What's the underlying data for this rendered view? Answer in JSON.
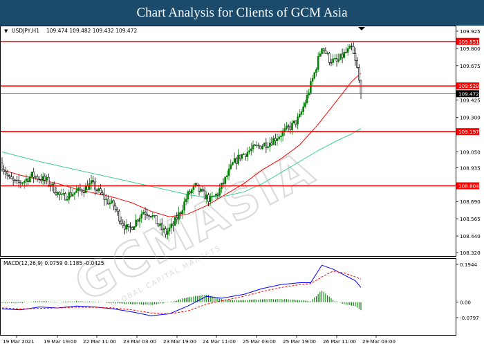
{
  "header": {
    "title": "Chart Analysis for Clients of GCM Asia"
  },
  "watermark": {
    "text": "GCMASIA",
    "subtext": "GLOBAL CAPITAL MARKETS"
  },
  "colors": {
    "bull_candle": "#008000",
    "bear_candle": "#000000",
    "fast_ma": "#ff0000",
    "slow_ma": "#3cd28c",
    "level_line": "#ff0000",
    "price_tag": "#000000",
    "macd_line": "#0000ff",
    "signal_line": "#ff0000",
    "histogram": "#008000"
  },
  "chart_data": [
    {
      "type": "candlestick",
      "symbol_label": "USDJPY,H1",
      "ohlc_label": "109.474 109.482 109.432 109.472",
      "y_ticks": [
        "109.925",
        "109.800",
        "109.675",
        "109.425",
        "109.300",
        "109.050",
        "108.935",
        "108.690",
        "108.565",
        "108.440",
        "108.320"
      ],
      "ylim": [
        108.32,
        109.925
      ],
      "levels": [
        {
          "value": 109.851,
          "label": "109.851"
        },
        {
          "value": 109.528,
          "label": "109.528"
        },
        {
          "value": 109.197,
          "label": "109.197"
        },
        {
          "value": 108.804,
          "label": "108.804"
        }
      ],
      "current_price": {
        "value": 109.472,
        "label": "109.472"
      },
      "x_ticks": [
        "19 Mar 2021",
        "19 Mar 19:00",
        "22 Mar 11:00",
        "23 Mar 03:00",
        "23 Mar 19:00",
        "24 Mar 11:00",
        "25 Mar 03:00",
        "25 Mar 19:00",
        "26 Mar 11:00",
        "29 Mar 03:00"
      ],
      "close_anchors": [
        [
          0,
          108.95
        ],
        [
          4,
          108.85
        ],
        [
          8,
          108.82
        ],
        [
          12,
          108.84
        ],
        [
          16,
          108.88
        ],
        [
          20,
          108.86
        ],
        [
          24,
          108.84
        ],
        [
          28,
          108.78
        ],
        [
          32,
          108.72
        ],
        [
          36,
          108.74
        ],
        [
          40,
          108.76
        ],
        [
          44,
          108.78
        ],
        [
          48,
          108.82
        ],
        [
          52,
          108.76
        ],
        [
          56,
          108.7
        ],
        [
          60,
          108.66
        ],
        [
          64,
          108.55
        ],
        [
          68,
          108.48
        ],
        [
          72,
          108.55
        ],
        [
          76,
          108.62
        ],
        [
          80,
          108.6
        ],
        [
          84,
          108.52
        ],
        [
          88,
          108.46
        ],
        [
          92,
          108.52
        ],
        [
          96,
          108.62
        ],
        [
          100,
          108.74
        ],
        [
          104,
          108.8
        ],
        [
          108,
          108.74
        ],
        [
          112,
          108.7
        ],
        [
          116,
          108.75
        ],
        [
          120,
          108.85
        ],
        [
          124,
          108.96
        ],
        [
          128,
          109.02
        ],
        [
          132,
          109.05
        ],
        [
          136,
          109.08
        ],
        [
          140,
          109.1
        ],
        [
          144,
          109.12
        ],
        [
          148,
          109.16
        ],
        [
          152,
          109.2
        ],
        [
          156,
          109.24
        ],
        [
          160,
          109.3
        ],
        [
          164,
          109.45
        ],
        [
          168,
          109.62
        ],
        [
          172,
          109.82
        ],
        [
          176,
          109.72
        ],
        [
          180,
          109.7
        ],
        [
          184,
          109.76
        ],
        [
          188,
          109.8
        ],
        [
          191,
          109.65
        ],
        [
          193,
          109.472
        ]
      ],
      "moving_averages": [
        {
          "name": "fast",
          "points": [
            [
              0,
              108.92
            ],
            [
              10,
              108.88
            ],
            [
              20,
              108.85
            ],
            [
              30,
              108.82
            ],
            [
              40,
              108.78
            ],
            [
              50,
              108.75
            ],
            [
              60,
              108.72
            ],
            [
              70,
              108.68
            ],
            [
              80,
              108.62
            ],
            [
              90,
              108.58
            ],
            [
              100,
              108.6
            ],
            [
              110,
              108.66
            ],
            [
              120,
              108.74
            ],
            [
              130,
              108.82
            ],
            [
              140,
              108.92
            ],
            [
              150,
              109.0
            ],
            [
              160,
              109.1
            ],
            [
              170,
              109.25
            ],
            [
              180,
              109.42
            ],
            [
              188,
              109.56
            ],
            [
              193,
              109.62
            ]
          ]
        },
        {
          "name": "slow",
          "points": [
            [
              0,
              109.05
            ],
            [
              20,
              108.98
            ],
            [
              40,
              108.92
            ],
            [
              60,
              108.86
            ],
            [
              80,
              108.8
            ],
            [
              100,
              108.74
            ],
            [
              110,
              108.72
            ],
            [
              120,
              108.73
            ],
            [
              130,
              108.76
            ],
            [
              140,
              108.82
            ],
            [
              150,
              108.9
            ],
            [
              160,
              108.98
            ],
            [
              170,
              109.06
            ],
            [
              180,
              109.13
            ],
            [
              188,
              109.18
            ],
            [
              193,
              109.22
            ]
          ]
        }
      ]
    },
    {
      "type": "macd",
      "label": "MACD(12,26,9) 0.0759 0.1185 -0.0425",
      "y_ticks": [
        "0.1944",
        "0.00",
        "-0.0797"
      ],
      "ylim": [
        -0.0797,
        0.1944
      ],
      "macd_points": [
        [
          0,
          -0.035
        ],
        [
          10,
          -0.04
        ],
        [
          20,
          -0.025
        ],
        [
          30,
          -0.03
        ],
        [
          40,
          -0.02
        ],
        [
          50,
          -0.025
        ],
        [
          60,
          -0.035
        ],
        [
          70,
          -0.05
        ],
        [
          80,
          -0.07
        ],
        [
          90,
          -0.06
        ],
        [
          100,
          -0.02
        ],
        [
          110,
          0.03
        ],
        [
          118,
          0.02
        ],
        [
          130,
          0.04
        ],
        [
          140,
          0.07
        ],
        [
          150,
          0.09
        ],
        [
          160,
          0.1
        ],
        [
          166,
          0.1
        ],
        [
          172,
          0.19
        ],
        [
          178,
          0.17
        ],
        [
          184,
          0.14
        ],
        [
          190,
          0.11
        ],
        [
          193,
          0.076
        ]
      ],
      "signal_points": [
        [
          0,
          -0.03
        ],
        [
          10,
          -0.035
        ],
        [
          20,
          -0.032
        ],
        [
          30,
          -0.03
        ],
        [
          40,
          -0.026
        ],
        [
          50,
          -0.027
        ],
        [
          60,
          -0.03
        ],
        [
          70,
          -0.04
        ],
        [
          80,
          -0.055
        ],
        [
          90,
          -0.06
        ],
        [
          100,
          -0.045
        ],
        [
          110,
          -0.01
        ],
        [
          120,
          0.01
        ],
        [
          130,
          0.03
        ],
        [
          140,
          0.055
        ],
        [
          150,
          0.075
        ],
        [
          160,
          0.09
        ],
        [
          166,
          0.095
        ],
        [
          172,
          0.13
        ],
        [
          178,
          0.16
        ],
        [
          184,
          0.15
        ],
        [
          190,
          0.13
        ],
        [
          193,
          0.1185
        ]
      ],
      "histogram_note": "difference of macd and signal"
    }
  ]
}
